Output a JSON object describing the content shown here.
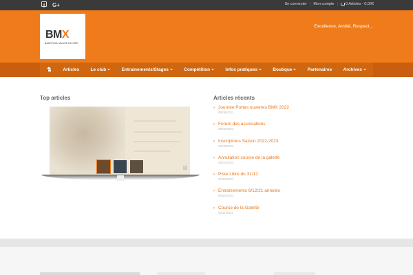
{
  "topbar": {
    "login": "Se connecter",
    "account": "Mon compte",
    "cart": "0 Articles - 0,00€"
  },
  "header": {
    "logo_main": "BM",
    "logo_x": "X",
    "logo_sub": "BADOTIVAL VALLÉE DU GIER",
    "tagline": "Excellence, Amitié, Respect..."
  },
  "nav": {
    "items": [
      {
        "label": "Articles",
        "dropdown": false
      },
      {
        "label": "Le club",
        "dropdown": true
      },
      {
        "label": "Entrainements/Stages",
        "dropdown": true
      },
      {
        "label": "Compétition",
        "dropdown": true
      },
      {
        "label": "Infos pratiques",
        "dropdown": true
      },
      {
        "label": "Boutique",
        "dropdown": true
      },
      {
        "label": "Partenaires",
        "dropdown": false
      },
      {
        "label": "Archives",
        "dropdown": true
      }
    ]
  },
  "main": {
    "top_title": "Top articles",
    "recent_title": "Articles récents",
    "recent": [
      {
        "title": "Journée Portes ouvertes BMX 2022",
        "date": "09/09/2022"
      },
      {
        "title": "Forum des associations",
        "date": "08/09/2022"
      },
      {
        "title": "Inscriptions Saison 2022-2023",
        "date": "25/08/2022"
      },
      {
        "title": "Annulation course de la galette",
        "date": "06/01/2022"
      },
      {
        "title": "Piste Libre du 31/12",
        "date": "30/12/2021"
      },
      {
        "title": "Entrainements 6/12/21 annulés",
        "date": "06/12/2021"
      },
      {
        "title": "Course de la Galette",
        "date": "05/11/2021"
      }
    ]
  },
  "colors": {
    "brand": "#f07b1a",
    "nav": "#cf6711",
    "topbar": "#3a3a3a"
  }
}
